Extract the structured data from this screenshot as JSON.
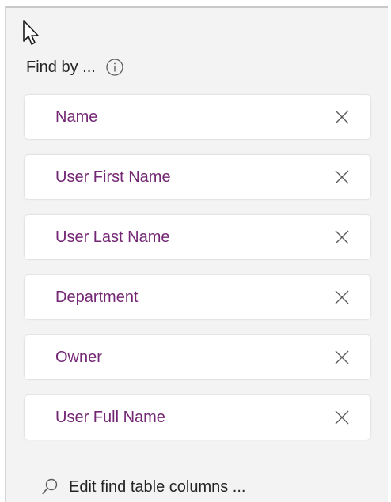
{
  "find_by": {
    "label": "Find by ...",
    "info_icon": "info-icon"
  },
  "fields": [
    {
      "label": "Name",
      "remove_icon": "close-icon"
    },
    {
      "label": "User First Name",
      "remove_icon": "close-icon"
    },
    {
      "label": "User Last Name",
      "remove_icon": "close-icon"
    },
    {
      "label": "Department",
      "remove_icon": "close-icon"
    },
    {
      "label": "Owner",
      "remove_icon": "close-icon"
    },
    {
      "label": "User Full Name",
      "remove_icon": "close-icon"
    }
  ],
  "edit_columns": {
    "label": "Edit find table columns ...",
    "icon": "search-icon"
  },
  "colors": {
    "field_text": "#742774",
    "panel_bg": "#f3f3f3",
    "icon": "#5c5c5c"
  }
}
